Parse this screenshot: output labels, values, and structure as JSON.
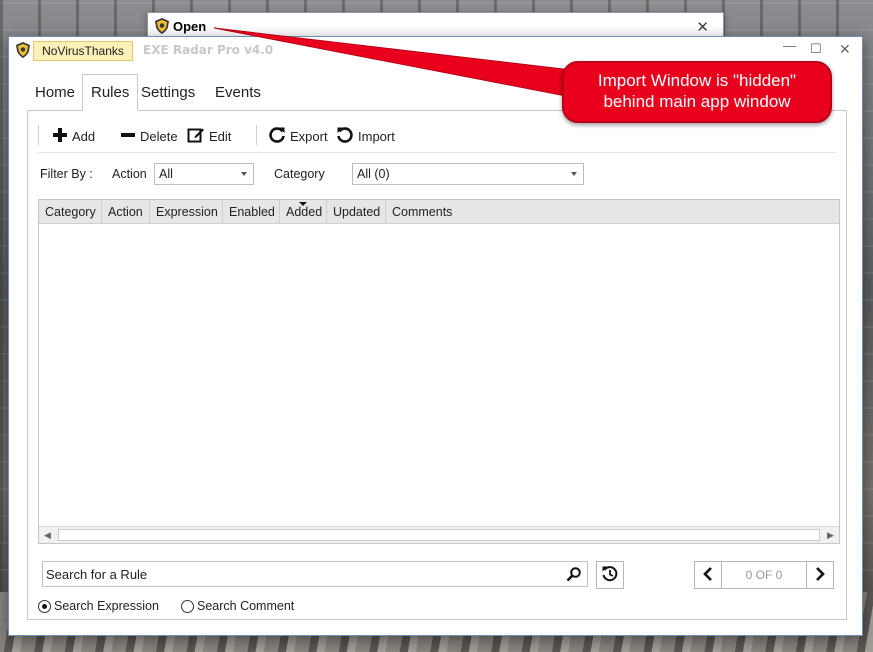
{
  "open_dialog": {
    "title": "Open",
    "close_glyph": "✕"
  },
  "main_window": {
    "brand_label": "NoVirusThanks",
    "title": "EXE Radar Pro v4.0",
    "controls": {
      "minimize": "—",
      "maximize": "☐",
      "close": "✕"
    }
  },
  "tabs": [
    {
      "label": "Home"
    },
    {
      "label": "Rules",
      "active": true
    },
    {
      "label": "Settings"
    },
    {
      "label": "Events"
    }
  ],
  "toolbar": {
    "add": "Add",
    "delete": "Delete",
    "edit": "Edit",
    "export": "Export",
    "import": "Import"
  },
  "filter": {
    "label": "Filter By :",
    "action_label": "Action",
    "action_value": "All",
    "category_label": "Category",
    "category_value": "All (0)"
  },
  "grid": {
    "columns": [
      "Category",
      "Action",
      "Expression",
      "Enabled",
      "Added",
      "Updated",
      "Comments"
    ],
    "sorted_column": "Added",
    "rows": []
  },
  "search": {
    "placeholder": "Search for a Rule"
  },
  "pager": {
    "count_text": "0 OF 0"
  },
  "search_mode": {
    "expression": "Search Expression",
    "comment": "Search Comment",
    "selected": "expression"
  },
  "annotation": {
    "line1": "Import Window is \"hidden\"",
    "line2": "behind main app window",
    "color": "#e8001c"
  },
  "icons": {
    "app": "shield-icon",
    "search": "search-icon",
    "reset": "reset-icon"
  }
}
